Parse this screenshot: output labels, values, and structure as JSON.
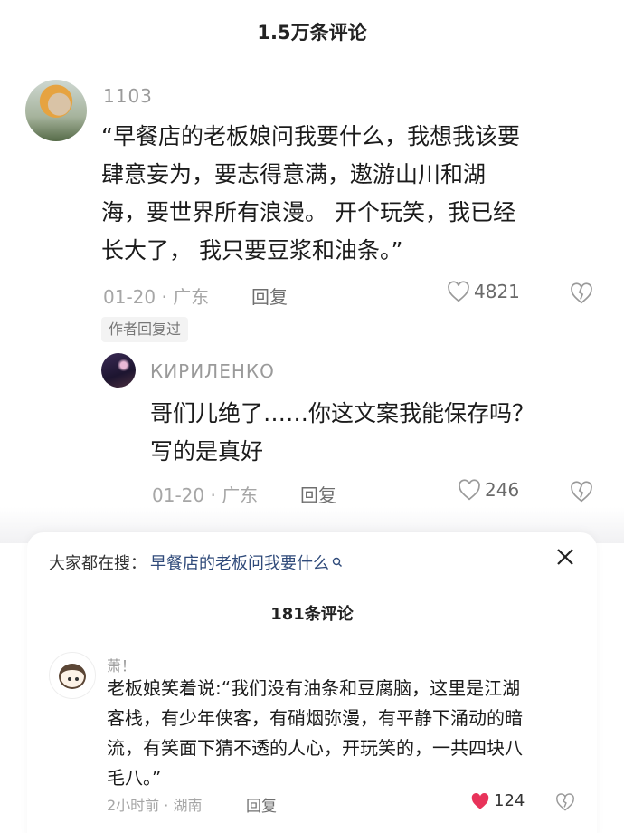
{
  "header": {
    "title": "1.5万条评论"
  },
  "comment1": {
    "username": "1103",
    "text_lines": [
      "“早餐店的老板娘问我要什么，我想我该要",
      "肆意妄为，要志得意满，遨游山川和湖",
      "海，要世界所有浪漫。 开个玩笑，我已经",
      "长大了， 我只要豆浆和油条。”"
    ],
    "date_location": "01-20 · 广东",
    "reply_label": "回复",
    "likes": "4821",
    "author_badge": "作者回复过"
  },
  "reply1": {
    "username": "КИРИЛЕНКО",
    "text_lines": [
      "哥们儿绝了……你这文案我能保存吗？",
      "写的是真好"
    ],
    "date_location": "01-20 · 广东",
    "reply_label": "回复",
    "likes": "246"
  },
  "sheet": {
    "search_prefix": "大家都在搜：",
    "search_query": "早餐店的老板问我要什么",
    "title": "181条评论"
  },
  "comment2": {
    "username": "萧！",
    "text_lines": [
      "老板娘笑着说:“我们没有油条和豆腐脑，这里是江湖",
      "客栈，有少年侠客，有硝烟弥漫，有平静下涌动的暗",
      "流，有笑面下猜不透的人心，开玩笑的，一共四块八",
      "毛八。”"
    ],
    "date_location": "2小时前 · 湖南",
    "reply_label": "回复",
    "likes": "124"
  },
  "colors": {
    "liked_heart": "#e8335a",
    "link_blue": "#2f4a7a",
    "muted_gray": "#a6a6a6"
  },
  "icons": [
    "heart-outline-icon",
    "heart-broken-icon",
    "search-icon",
    "close-icon",
    "heart-filled-icon"
  ]
}
